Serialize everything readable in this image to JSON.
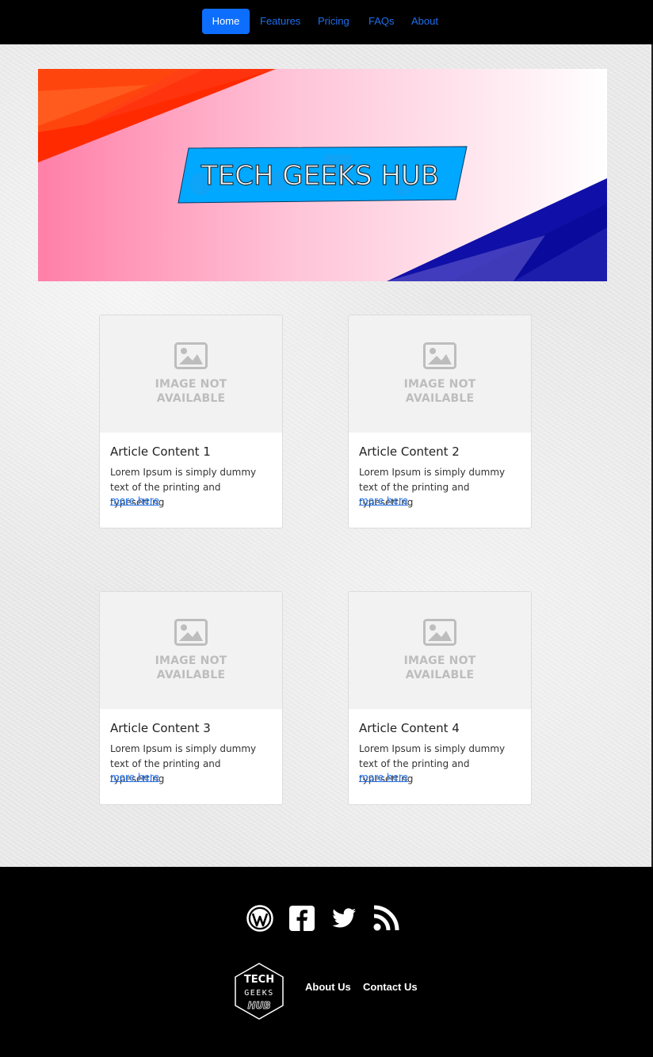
{
  "nav": {
    "items": [
      {
        "label": "Home",
        "active": true
      },
      {
        "label": "Features"
      },
      {
        "label": "Pricing"
      },
      {
        "label": "FAQs"
      },
      {
        "label": "About"
      }
    ]
  },
  "banner": {
    "title": "TECH GEEKS HUB"
  },
  "cards": [
    {
      "placeholder_line1": "IMAGE NOT",
      "placeholder_line2": "AVAILABLE",
      "title": "Article Content 1",
      "text": "Lorem Ipsum is simply dummy text of the printing and typesetting",
      "link": "more here"
    },
    {
      "placeholder_line1": "IMAGE NOT",
      "placeholder_line2": "AVAILABLE",
      "title": "Article Content 2",
      "text": "Lorem Ipsum is simply dummy text of the printing and typesetting",
      "link": "more here"
    },
    {
      "placeholder_line1": "IMAGE NOT",
      "placeholder_line2": "AVAILABLE",
      "title": "Article Content 3",
      "text": "Lorem Ipsum is simply dummy text of the printing and typesetting",
      "link": "more here"
    },
    {
      "placeholder_line1": "IMAGE NOT",
      "placeholder_line2": "AVAILABLE",
      "title": "Article Content 4",
      "text": "Lorem Ipsum is simply dummy text of the printing and typesetting",
      "link": "more here"
    }
  ],
  "footer": {
    "social_icons": [
      "wordpress-icon",
      "facebook-icon",
      "twitter-icon",
      "rss-icon"
    ],
    "logo_lines": [
      "TECH",
      "GEEKS",
      "HUB"
    ],
    "links": [
      "About Us",
      "Contact Us"
    ]
  },
  "colors": {
    "nav_bg": "#000000",
    "active": "#0d6efd",
    "link": "#1f6feb",
    "footer_bg": "#000000"
  }
}
